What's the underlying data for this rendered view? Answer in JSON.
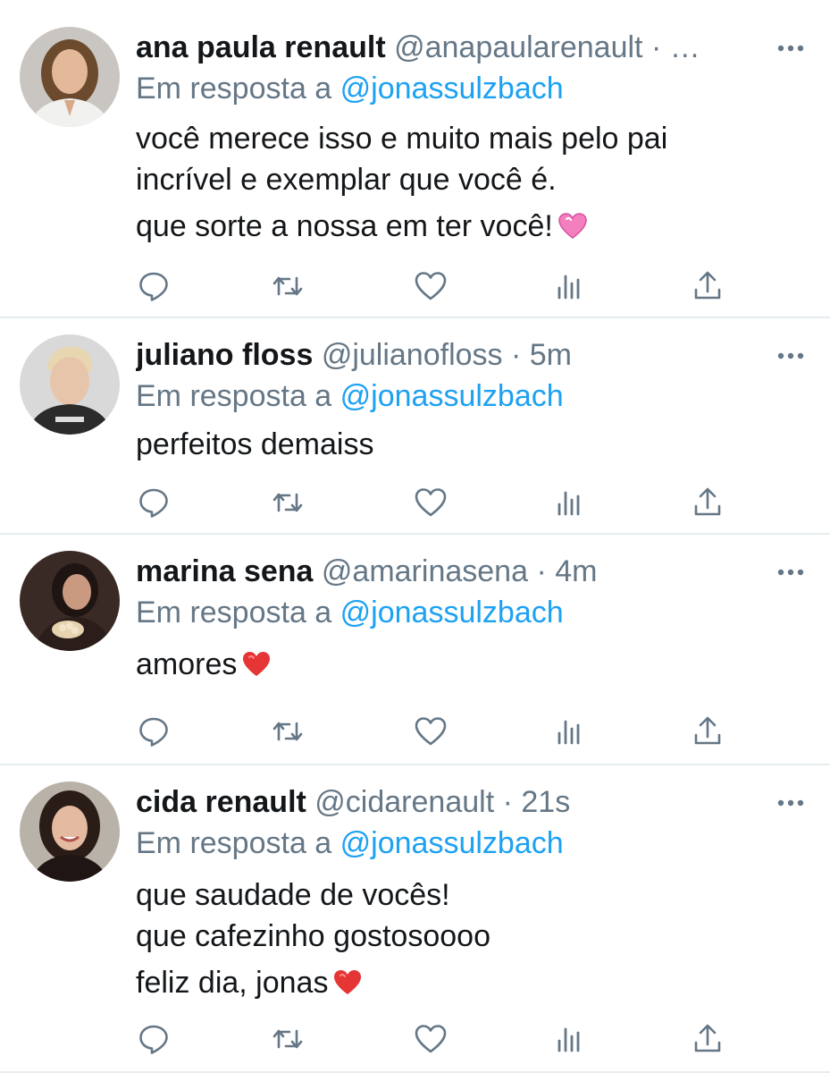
{
  "replies": [
    {
      "name": "ana paula renault",
      "handle": "@anapaularenault",
      "time": "· …",
      "reply_prefix": "Em resposta a",
      "reply_mention": "@jonassulzbach",
      "lines": [
        "você merece isso e muito mais pelo pai",
        "incrível e exemplar que você é."
      ],
      "line2": "que sorte a nossa em ter você!",
      "emoji": "pink-heart"
    },
    {
      "name": "juliano floss",
      "handle": "@julianofloss",
      "time": "· 5m",
      "reply_prefix": "Em resposta a",
      "reply_mention": "@jonassulzbach",
      "lines": [
        "perfeitos demaiss"
      ]
    },
    {
      "name": "marina sena",
      "handle": "@amarinasena",
      "time": "· 4m",
      "reply_prefix": "Em resposta a",
      "reply_mention": "@jonassulzbach",
      "line1": "amores",
      "emoji": "red-heart"
    },
    {
      "name": "cida renault",
      "handle": "@cidarenault",
      "time": "· 21s",
      "reply_prefix": "Em resposta a",
      "reply_mention": "@jonassulzbach",
      "lines": [
        "que saudade de vocês!",
        "que cafezinho gostosoooo"
      ],
      "line3": "feliz dia, jonas",
      "emoji": "red-heart"
    }
  ],
  "icons": {
    "reply": "reply-icon",
    "retweet": "retweet-icon",
    "like": "like-icon",
    "analytics": "analytics-icon",
    "share": "share-icon",
    "more": "more-icon"
  },
  "colors": {
    "text": "#14171a",
    "secondary": "#657786",
    "link": "#1da1f2",
    "divider": "#e6ecf0"
  }
}
